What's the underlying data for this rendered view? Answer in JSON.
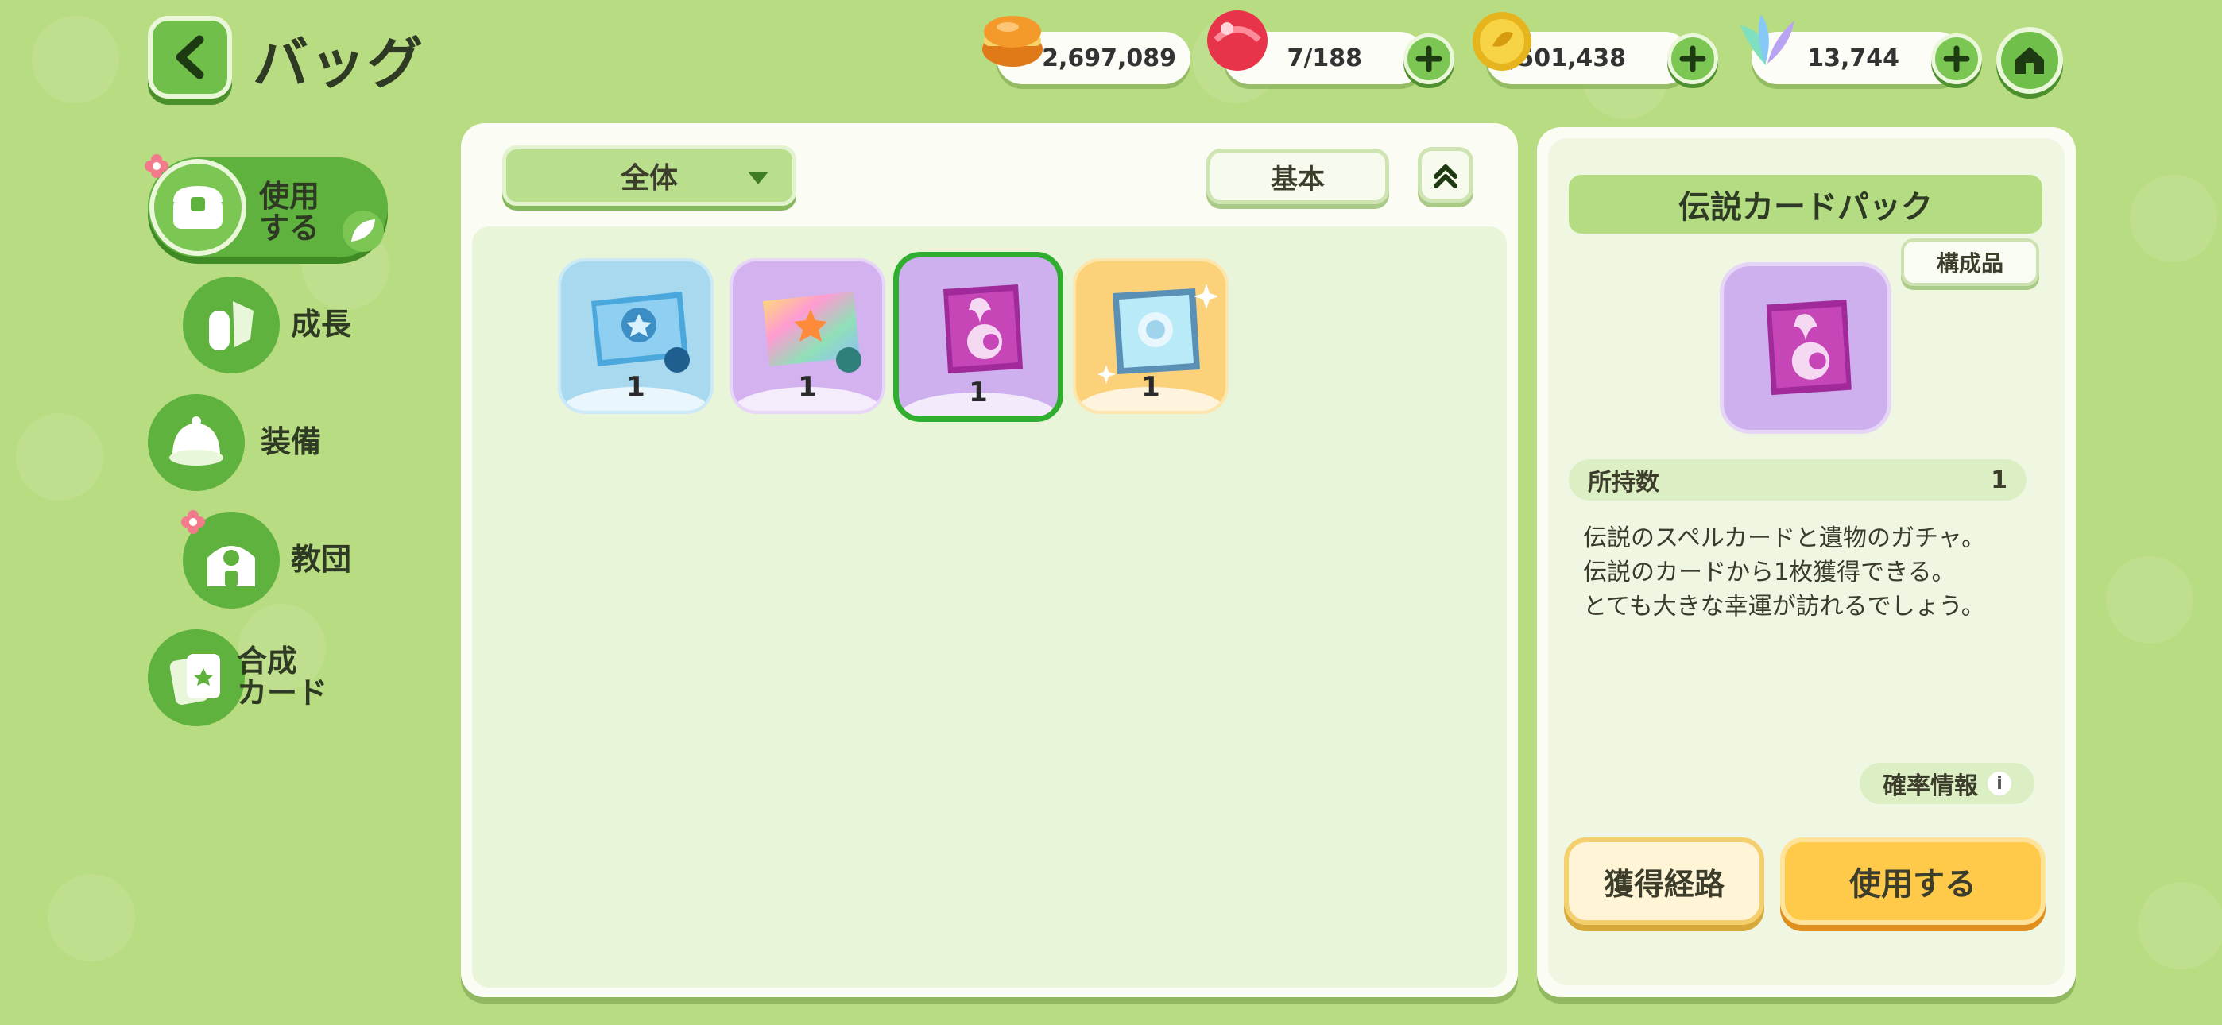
{
  "header": {
    "title": "バッグ",
    "currencies": [
      {
        "name": "cookie",
        "value": "2,697,089"
      },
      {
        "name": "candy",
        "value": "7/188"
      },
      {
        "name": "gold-coin",
        "value": "6,501,438"
      },
      {
        "name": "crystal-leaf",
        "value": "13,744"
      }
    ]
  },
  "sidebar": {
    "items": [
      {
        "label": "使用\nする",
        "icon": "chest-icon",
        "active": true
      },
      {
        "label": "成長",
        "icon": "potion-icon"
      },
      {
        "label": "装備",
        "icon": "hat-icon"
      },
      {
        "label": "教団",
        "icon": "building-icon"
      },
      {
        "label": "合成\nカード",
        "icon": "card-icon"
      }
    ]
  },
  "main": {
    "filter_label": "全体",
    "sort_label": "基本",
    "items": [
      {
        "name": "blue-ticket",
        "count": "1",
        "color": "#a9d9ef"
      },
      {
        "name": "rainbow-ticket",
        "count": "1",
        "color": "#d3b2ef"
      },
      {
        "name": "legend-card-pack",
        "count": "1",
        "color": "#cfb0ef",
        "selected": true
      },
      {
        "name": "gold-card-pack",
        "count": "1",
        "color": "#fbd27a"
      }
    ]
  },
  "detail": {
    "title": "伝説カードパック",
    "components_label": "構成品",
    "owned_label": "所持数",
    "owned_value": "1",
    "description": [
      "伝説のスペルカードと遺物のガチャ。",
      "伝説のカードから1枚獲得できる。",
      "とても大きな幸運が訪れるでしょう。"
    ],
    "odds_label": "確率情報",
    "source_label": "獲得経路",
    "use_label": "使用する"
  },
  "colors": {
    "background": "#b8dc82",
    "accent_green": "#5fb23e",
    "selected_border": "#2fae2f",
    "use_button": "#ffc94a"
  }
}
